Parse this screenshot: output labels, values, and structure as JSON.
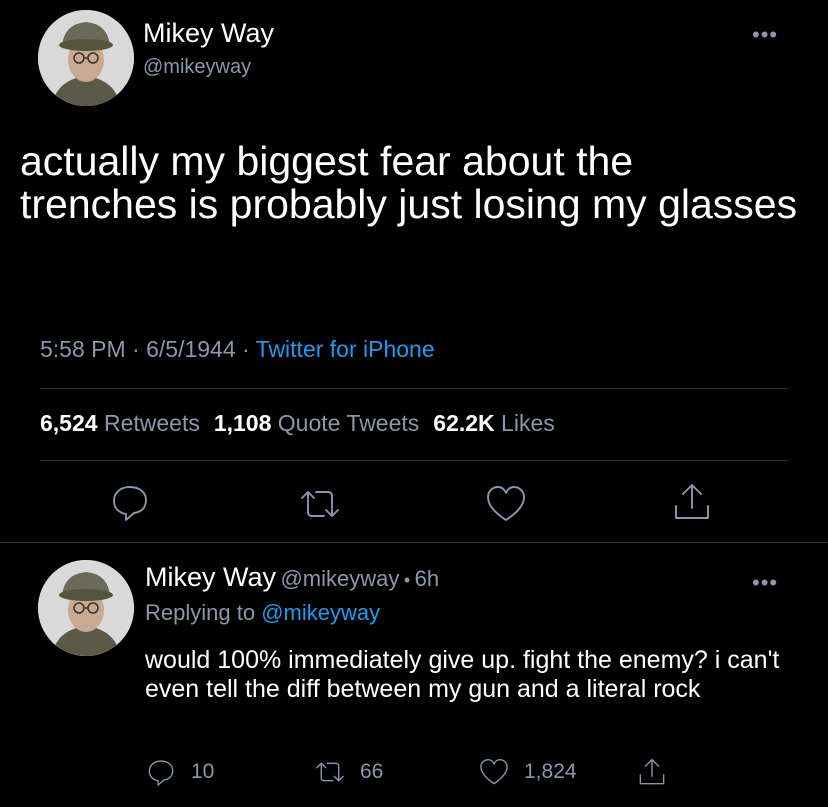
{
  "main_tweet": {
    "author_name": "Mikey Way",
    "author_handle": "@mikeyway",
    "more_label": "•••",
    "text": "actually my biggest fear about the trenches is probably just losing my glasses",
    "time": "5:58 PM",
    "sep1": " · ",
    "date": "6/5/1944",
    "sep2": " · ",
    "source": "Twitter for iPhone",
    "stats": {
      "retweets_count": "6,524",
      "retweets_label": "Retweets",
      "quotes_count": "1,108",
      "quotes_label": "Quote Tweets",
      "likes_count": "62.2K",
      "likes_label": "Likes"
    },
    "actions": [
      "reply-icon",
      "retweet-icon",
      "like-icon",
      "share-icon"
    ]
  },
  "reply": {
    "author_name": "Mikey Way",
    "author_handle": "@mikeyway",
    "dot": "•",
    "time_ago": "6h",
    "more_label": "•••",
    "replying_prefix": "Replying to",
    "replying_to": "@mikeyway",
    "text": "would 100% immediately give up. fight the enemy? i can't even tell the diff between my gun and a literal rock",
    "reply_count": "10",
    "retweet_count": "66",
    "like_count": "1,824"
  },
  "colors": {
    "background": "#000000",
    "text": "#ffffff",
    "muted": "#8b98a5",
    "link": "#1d9bf0",
    "divider": "#2f3336"
  }
}
